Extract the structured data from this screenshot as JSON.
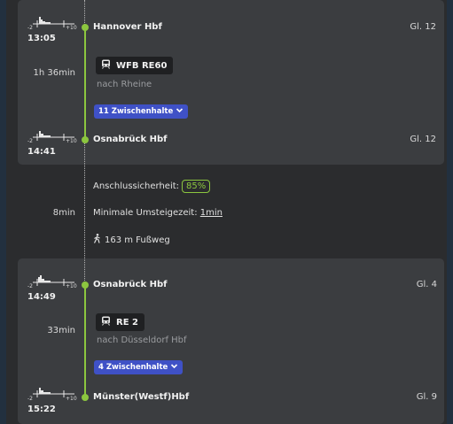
{
  "histogram": {
    "left_label": "-2",
    "right_label": "+10"
  },
  "legs": [
    {
      "departure": {
        "time": "13:05",
        "station": "Hannover Hbf",
        "platform": "Gl. 12"
      },
      "duration": "1h 36min",
      "train": "WFB RE60",
      "train_icon": "train-icon",
      "direction": "nach Rheine",
      "stops_label": "11 Zwischenhalte",
      "arrival": {
        "time": "14:41",
        "station": "Osnabrück Hbf",
        "platform": "Gl. 12"
      }
    },
    {
      "departure": {
        "time": "14:49",
        "station": "Osnabrück Hbf",
        "platform": "Gl. 4"
      },
      "duration": "33min",
      "train": "RE 2",
      "train_icon": "train-icon",
      "direction": "nach Düsseldorf Hbf",
      "stops_label": "4 Zwischenhalte",
      "arrival": {
        "time": "15:22",
        "station": "Münster(Westf)Hbf",
        "platform": "Gl. 9"
      }
    }
  ],
  "transfer": {
    "duration": "8min",
    "reliability_label": "Anschlussicherheit:",
    "reliability_value": "85%",
    "min_transfer_label": "Minimale Umsteigezeit:",
    "min_transfer_value": "1min",
    "walk_icon": "walking-icon",
    "walk": "163 m Fußweg"
  },
  "colors": {
    "line": "#8cc63f",
    "badge_stops": "#3f51c6",
    "card": "#3b3d40",
    "background": "#2b2c2e"
  }
}
